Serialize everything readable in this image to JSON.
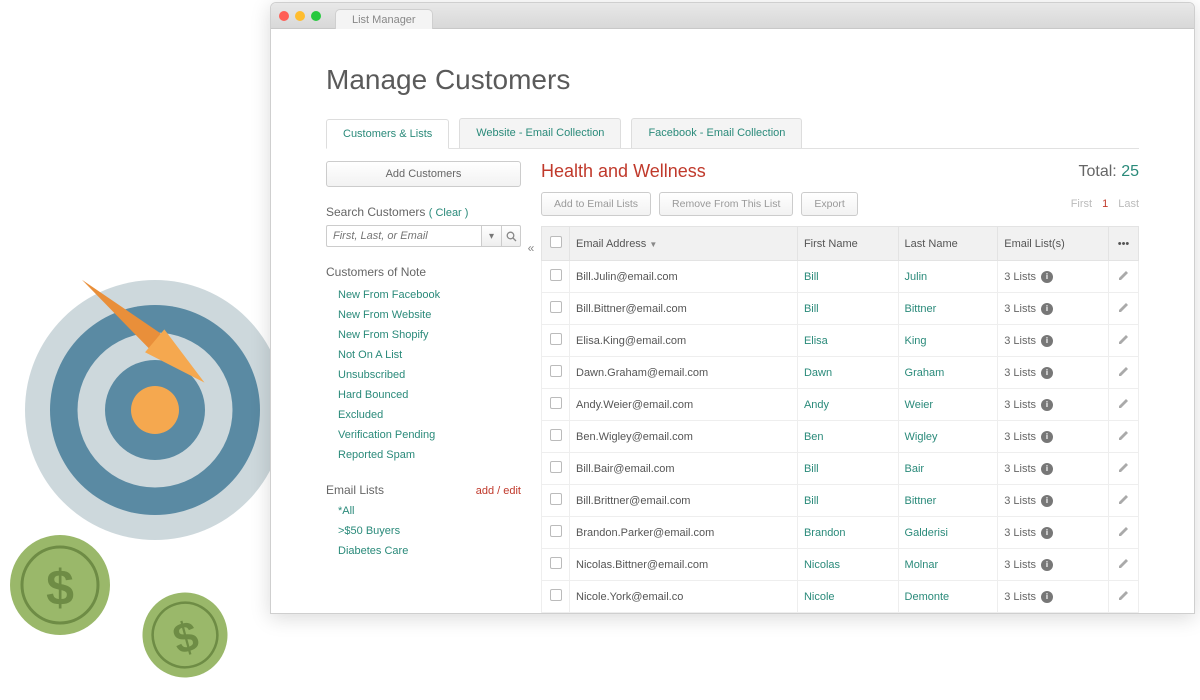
{
  "window": {
    "tab_label": "List Manager"
  },
  "page_title": "Manage Customers",
  "tabs": [
    {
      "label": "Customers & Lists",
      "active": true
    },
    {
      "label": "Website - Email Collection",
      "active": false
    },
    {
      "label": "Facebook - Email Collection",
      "active": false
    }
  ],
  "sidebar": {
    "add_button": "Add Customers",
    "search_title": "Search Customers",
    "clear_label": "( Clear )",
    "search_placeholder": "First, Last, or Email",
    "notes_title": "Customers of Note",
    "notes": [
      "New From Facebook",
      "New From Website",
      "New From Shopify",
      "Not On A List",
      "Unsubscribed",
      "Hard Bounced",
      "Excluded",
      "Verification Pending",
      "Reported Spam"
    ],
    "email_lists_title": "Email Lists",
    "add_edit_label": "add / edit",
    "email_lists": [
      "*All",
      ">$50 Buyers",
      "Diabetes Care"
    ]
  },
  "main": {
    "list_title": "Health and Wellness",
    "total_label": "Total:",
    "total_value": "25",
    "actions": {
      "add": "Add to Email Lists",
      "remove": "Remove From This List",
      "export": "Export"
    },
    "pager": {
      "first": "First",
      "current": "1",
      "last": "Last"
    },
    "columns": {
      "email": "Email Address",
      "first": "First Name",
      "last": "Last Name",
      "lists": "Email List(s)"
    },
    "rows": [
      {
        "email": "Bill.Julin@email.com",
        "first": "Bill",
        "last": "Julin",
        "lists": "3 Lists"
      },
      {
        "email": "Bill.Bittner@email.com",
        "first": "Bill",
        "last": "Bittner",
        "lists": "3 Lists"
      },
      {
        "email": "Elisa.King@email.com",
        "first": "Elisa",
        "last": "King",
        "lists": "3 Lists"
      },
      {
        "email": "Dawn.Graham@email.com",
        "first": "Dawn",
        "last": "Graham",
        "lists": "3 Lists"
      },
      {
        "email": "Andy.Weier@email.com",
        "first": "Andy",
        "last": "Weier",
        "lists": "3 Lists"
      },
      {
        "email": "Ben.Wigley@email.com",
        "first": "Ben",
        "last": "Wigley",
        "lists": "3 Lists"
      },
      {
        "email": "Bill.Bair@email.com",
        "first": "Bill",
        "last": "Bair",
        "lists": "3 Lists"
      },
      {
        "email": "Bill.Brittner@email.com",
        "first": "Bill",
        "last": "Bittner",
        "lists": "3 Lists"
      },
      {
        "email": "Brandon.Parker@email.com",
        "first": "Brandon",
        "last": "Galderisi",
        "lists": "3 Lists"
      },
      {
        "email": "Nicolas.Bittner@email.com",
        "first": "Nicolas",
        "last": "Molnar",
        "lists": "3 Lists"
      },
      {
        "email": "Nicole.York@email.co",
        "first": "Nicole",
        "last": "Demonte",
        "lists": "3 Lists"
      }
    ]
  }
}
